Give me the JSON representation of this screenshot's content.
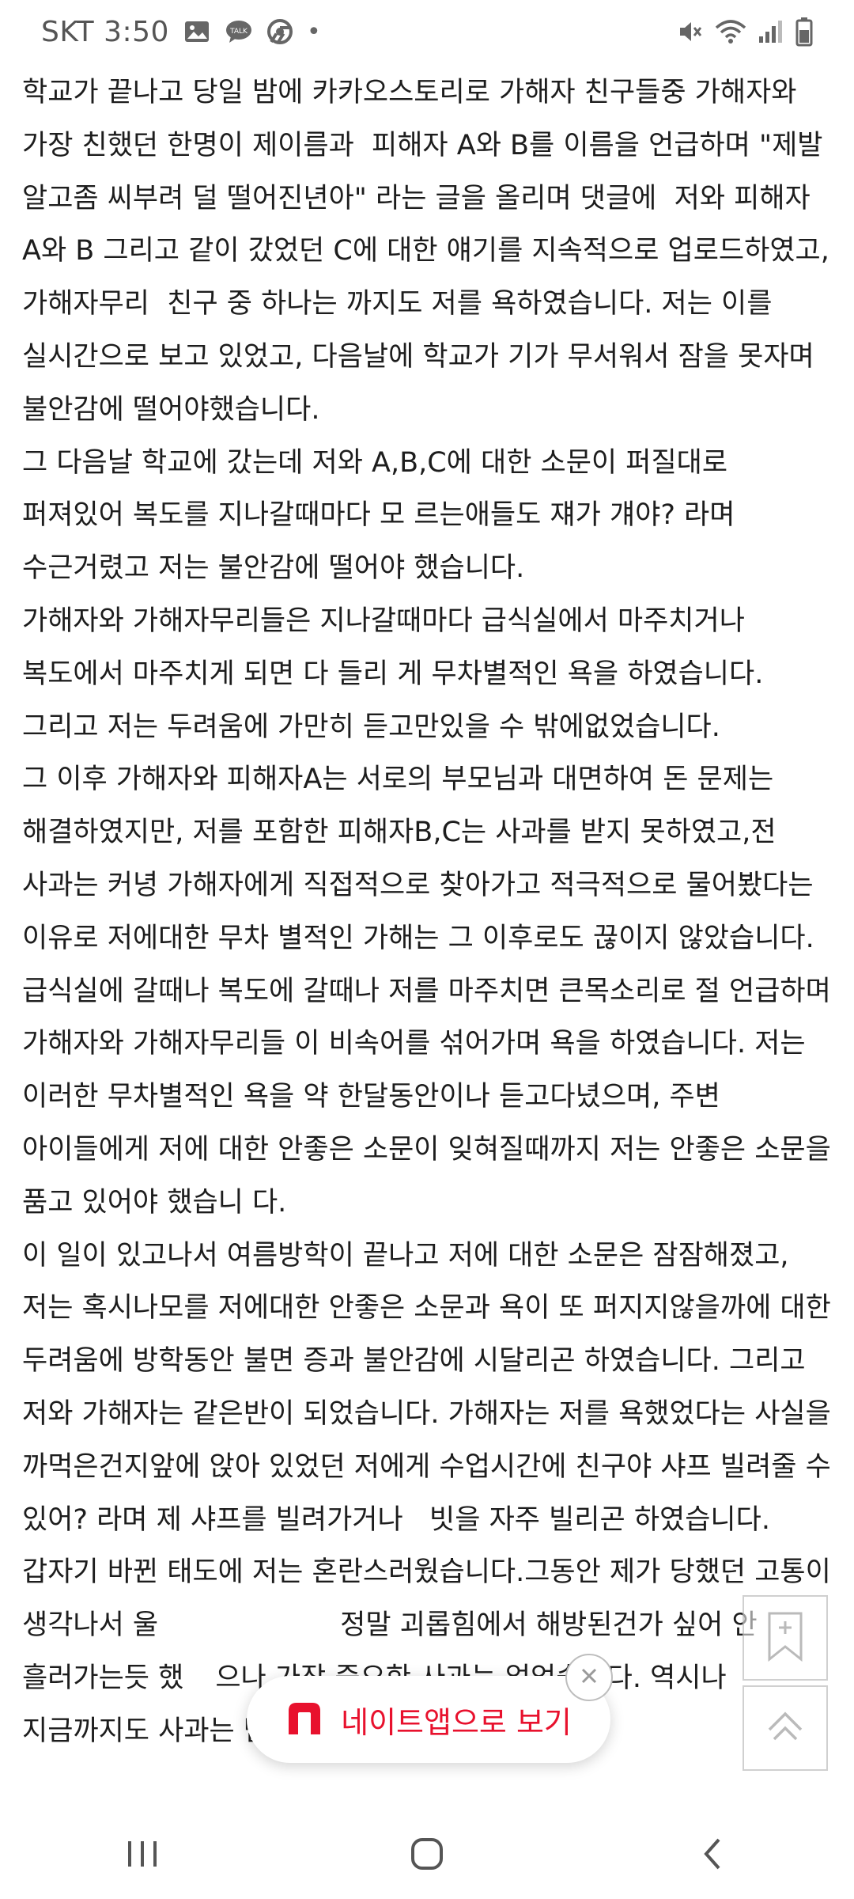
{
  "status_bar": {
    "carrier": "SKT",
    "time": "3:50",
    "dot": "•",
    "icons_left": [
      "image-icon",
      "talk-icon",
      "chrome-icon"
    ],
    "icons_right": [
      "mute-icon",
      "wifi-icon",
      "signal-icon",
      "battery-icon"
    ]
  },
  "article": {
    "paragraphs": [
      "학교가 끝나고 당일 밤에 카카오스토리로 가해자 친구들중 가해자와 가장 친했던 한명이 제이름과  피해자 A와 B를 이름을 언급하며 \"제발 알고좀 씨부려 덜 떨어진년아\" 라는 글을 올리며 댓글에  저와 피해자 A와 B 그리고 같이 갔었던 C에 대한 얘기를 지속적으로 업로드하였고, 가해자무리  친구 중 하나는 까지도 저를 욕하였습니다. 저는 이를 실시간으로 보고 있었고, 다음날에 학교가 기가 무서워서 잠을 못자며 불안감에 떨어야했습니다.",
      "그 다음날 학교에 갔는데 저와 A,B,C에 대한 소문이 퍼질대로 퍼져있어 복도를 지나갈때마다 모 르는애들도 쟤가 걔야? 라며 수근거렸고 저는 불안감에 떨어야 했습니다.",
      "가해자와 가해자무리들은 지나갈때마다 급식실에서 마주치거나 복도에서 마주치게 되면 다 들리 게 무차별적인 욕을 하였습니다. 그리고 저는 두려움에 가만히 듣고만있을 수 밖에없었습니다.",
      "그 이후 가해자와 피해자A는 서로의 부모님과 대면하여 돈 문제는 해결하였지만, 저를 포함한 피해자B,C는 사과를 받지 못하였고,전 사과는 커녕 가해자에게 직접적으로 찾아가고 적극적으로 물어봤다는 이유로 저에대한 무차 별적인 가해는 그 이후로도 끊이지 않았습니다.급식실에 갈때나 복도에 갈때나 저를 마주치면 큰목소리로 절 언급하며 가해자와 가해자무리들 이 비속어를 섞어가며 욕을 하였습니다. 저는 이러한 무차별적인 욕을 약 한달동안이나 듣고다녔으며, 주변 아이들에게 저에 대한 안좋은 소문이 잊혀질때까지 저는 안좋은 소문을 품고 있어야 했습니 다.",
      "이 일이 있고나서 여름방학이 끝나고 저에 대한 소문은 잠잠해졌고, 저는 혹시나모를 저에대한 안좋은 소문과 욕이 또 퍼지지않을까에 대한 두려움에 방학동안 불면 증과 불안감에 시달리곤 하였습니다. 그리고 저와 가해자는 같은반이 되었습니다. 가해자는 저를 욕했었다는 사실을 까먹은건지앞에 앉아 있었던 저에게 수업시간에 친구야 샤프 빌려줄 수 있어? 라며 제 샤프를 빌려가거나   빗을 자주 빌리곤 하였습니다.",
      "갑자기 바뀐 태도에 저는 혼란스러웠습니다.그동안 제가 당했던 고통이 생각나서 울",
      "정말 괴롭힘에서 해방된건가 싶어 안",
      "흘러가는듯 했",
      "으나 가장 중요한 사과는 없었습니다. 역시나 지금까지도 사과는 받"
    ]
  },
  "floating": {
    "bookmark_icon": "bookmark-icon",
    "scroll_top_icon": "scroll-top-icon"
  },
  "banner": {
    "text": "네이트앱으로 보기",
    "logo_letter": "n",
    "brand_color": "#e8112d",
    "close_icon": "close-icon"
  },
  "nav": {
    "icons": [
      "recent-apps-icon",
      "home-icon",
      "back-icon"
    ]
  }
}
